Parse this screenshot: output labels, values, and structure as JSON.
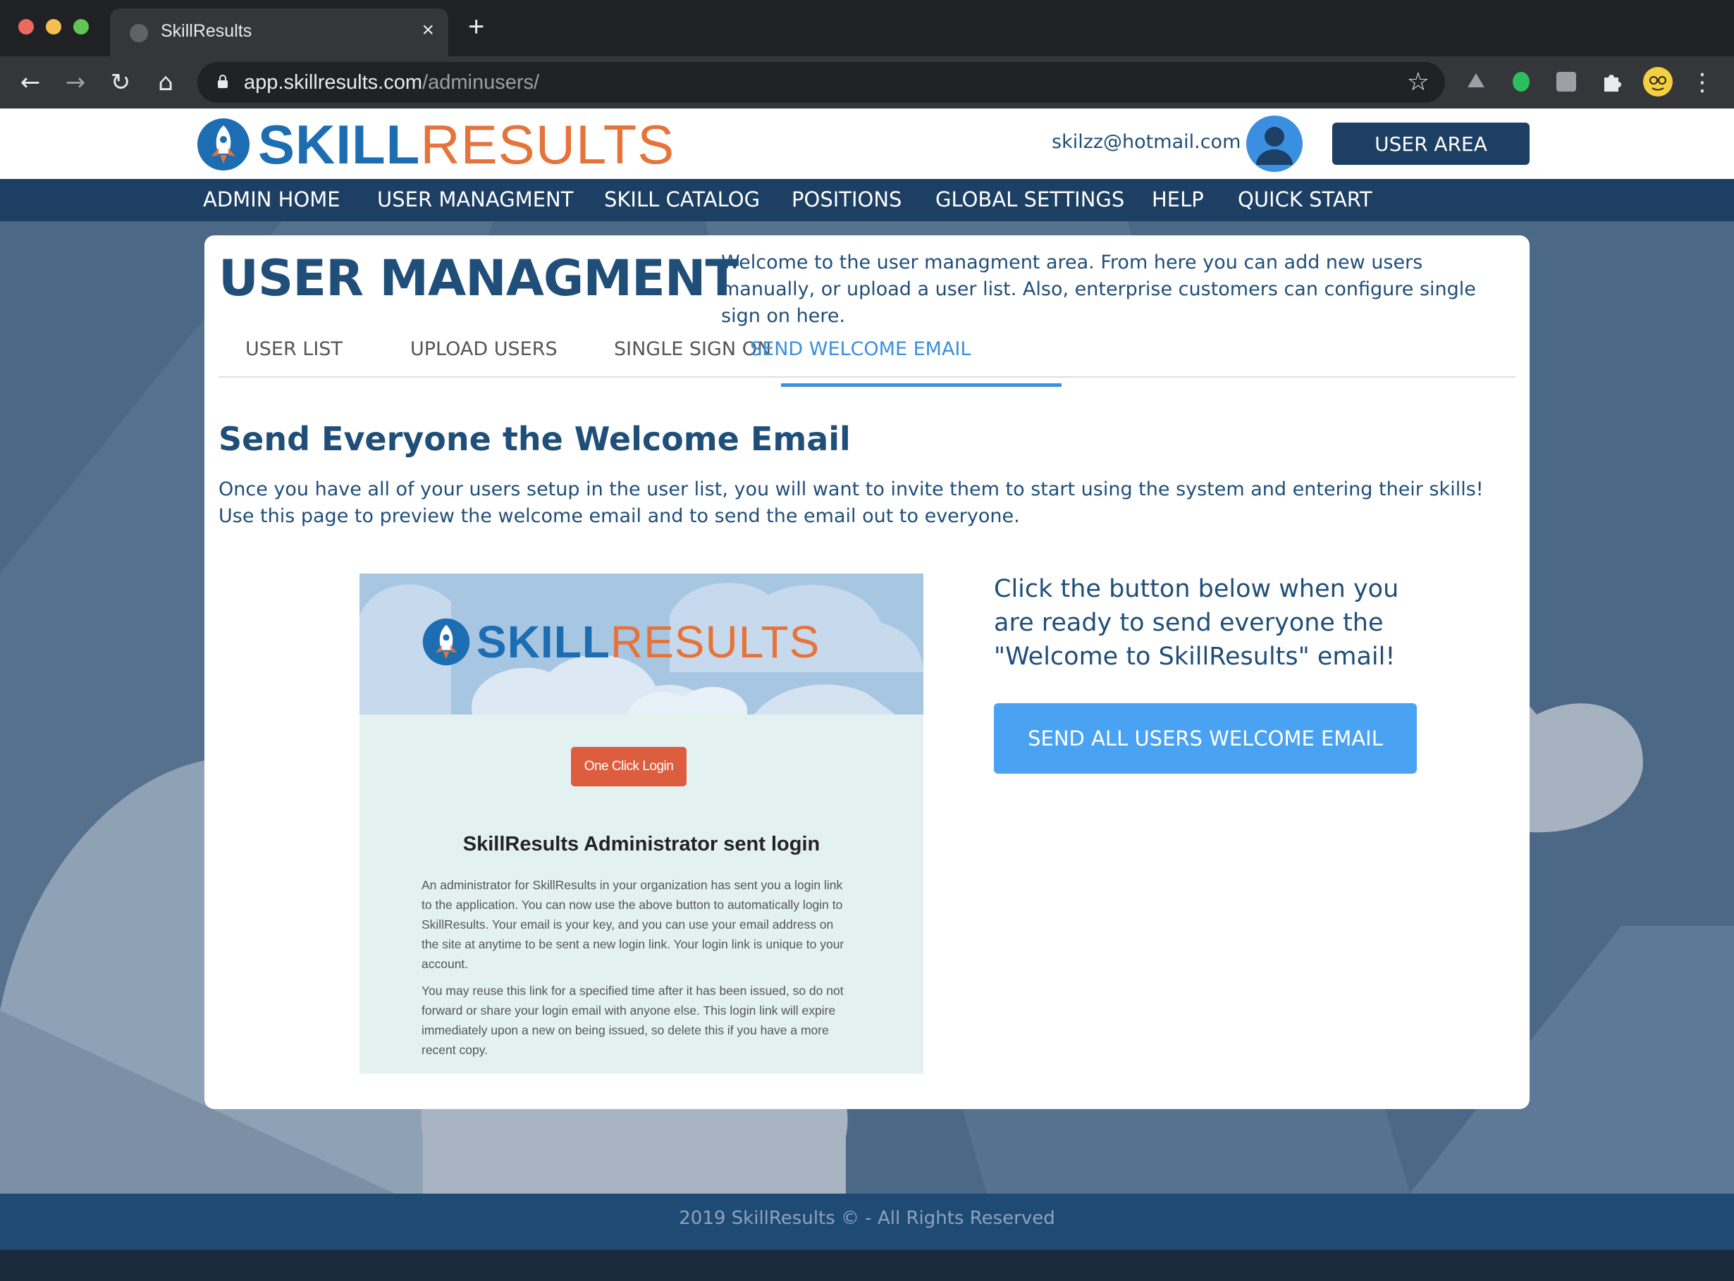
{
  "browser": {
    "tab_title": "SkillResults",
    "tab_close": "×",
    "new_tab": "+",
    "url_host": "app.skillresults.com",
    "url_path": "/adminusers/",
    "back": "←",
    "forward": "→",
    "reload": "↻",
    "home": "⌂",
    "star": "☆",
    "menu": "⋮"
  },
  "header": {
    "logo_skill": "SKILL",
    "logo_results": "RESULTS",
    "user_email": "skilzz@hotmail.com",
    "user_area_label": "USER AREA"
  },
  "nav": {
    "items": [
      {
        "label": "ADMIN HOME"
      },
      {
        "label": "USER MANAGMENT"
      },
      {
        "label": "SKILL CATALOG"
      },
      {
        "label": "POSITIONS"
      },
      {
        "label": "GLOBAL SETTINGS"
      },
      {
        "label": "HELP"
      },
      {
        "label": "QUICK START"
      }
    ]
  },
  "page": {
    "title": "USER MANAGMENT",
    "intro": "Welcome to the user managment area. From here you can add new users manually, or upload a user list. Also, enterprise customers can configure single sign on here.",
    "tabs": [
      {
        "label": "USER LIST"
      },
      {
        "label": "UPLOAD USERS"
      },
      {
        "label": "SINGLE SIGN ON"
      },
      {
        "label": "SEND WELCOME EMAIL",
        "active": true
      }
    ],
    "section_title": "Send Everyone the Welcome Email",
    "section_body": "Once you have all of your users setup in the user list, you will want to invite them to start using the system and entering their skills! Use this page to preview the welcome email and to send the email out to everyone.",
    "cta_text": "Click the button below when you are ready to send everyone the \"Welcome to SkillResults\" email!",
    "send_button": "SEND ALL USERS WELCOME EMAIL"
  },
  "preview": {
    "logo_skill": "SKILL",
    "logo_results": "RESULTS",
    "one_click_login": "One Click Login",
    "heading": "SkillResults Administrator sent login",
    "paragraph1": "An administrator for SkillResults in your organization has sent you a login link to the application. You can now use the above button to automatically login to SkillResults. Your email is your key, and you can use your email address on the site at anytime to be sent a new login link. Your login link is unique to your account.",
    "paragraph2": "You may reuse this link for a specified time after it has been issued, so do not forward or share your login email with anyone else. This login link will expire immediately upon a new on being issued, so delete this if you have a more recent copy."
  },
  "footer": {
    "copyright": "2019 SkillResults © - All Rights Reserved"
  },
  "colors": {
    "brand_dark": "#1c3f63",
    "brand_blue": "#1d6db3",
    "brand_orange": "#e6733a",
    "accent": "#4aa2f3",
    "text": "#1f4e79"
  }
}
